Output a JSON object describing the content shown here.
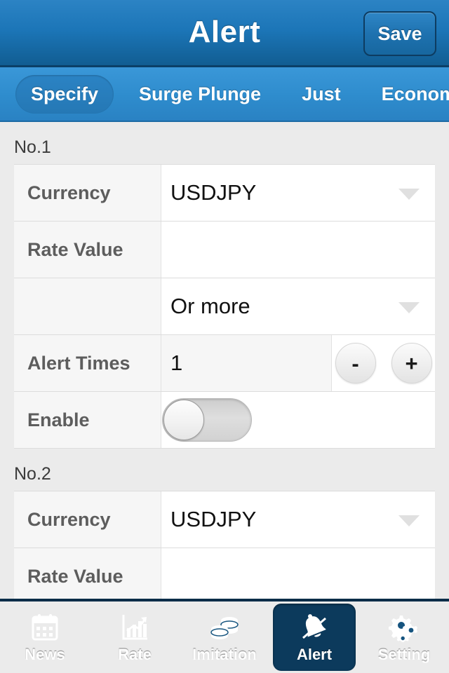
{
  "header": {
    "title": "Alert",
    "save_label": "Save"
  },
  "segmented": {
    "items": [
      {
        "label": "Specify",
        "active": true
      },
      {
        "label": "Surge Plunge",
        "active": false
      },
      {
        "label": "Just",
        "active": false
      },
      {
        "label": "Economic",
        "active": false
      }
    ]
  },
  "groups": [
    {
      "title": "No.1",
      "rows": [
        {
          "type": "select",
          "label": "Currency",
          "value": "USDJPY",
          "caret": true
        },
        {
          "type": "input",
          "label": "Rate Value",
          "value": "",
          "placeholder": ""
        },
        {
          "type": "select",
          "label": "",
          "value": "Or more",
          "caret": true
        },
        {
          "type": "stepper",
          "label": "Alert Times",
          "value": "1",
          "minus_label": "-",
          "plus_label": "+"
        },
        {
          "type": "toggle",
          "label": "Enable",
          "value": "",
          "on": false
        }
      ]
    },
    {
      "title": "No.2",
      "rows": [
        {
          "type": "select",
          "label": "Currency",
          "value": "USDJPY",
          "caret": true
        },
        {
          "type": "input",
          "label": "Rate Value",
          "value": "",
          "placeholder": ""
        }
      ]
    }
  ],
  "tabbar": {
    "items": [
      {
        "label": "News",
        "icon": "calendar-icon",
        "active": false
      },
      {
        "label": "Rate",
        "icon": "bar-chart-icon",
        "active": false
      },
      {
        "label": "Imitation",
        "icon": "coins-icon",
        "active": false
      },
      {
        "label": "Alert",
        "icon": "bell-icon",
        "active": true
      },
      {
        "label": "Setting",
        "icon": "gears-icon",
        "active": false
      }
    ]
  },
  "colors": {
    "header_blue": "#1c76b8",
    "segbar_blue": "#2e8ccd",
    "tabbar_blue": "#14507c",
    "active_tab_bg": "#0c3a5c",
    "page_bg": "#ebebeb",
    "label_bg": "#f6f6f6"
  }
}
